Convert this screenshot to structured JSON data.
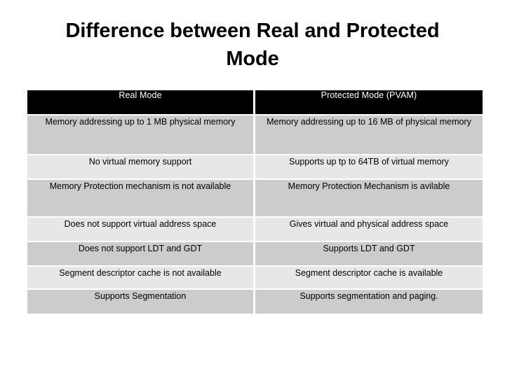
{
  "slide": {
    "title": "Difference between Real and Protected Mode",
    "background_color": "#ffffff"
  },
  "table": {
    "header_background": "#000000",
    "header_text_color": "#ffffff",
    "row_shade_dark": "#cccccc",
    "row_shade_light": "#e7e7e7",
    "columns": [
      {
        "label": "Real Mode"
      },
      {
        "label": "Protected Mode (PVAM)"
      }
    ],
    "rows": [
      {
        "left": "Memory addressing up to 1 MB physical memory",
        "right": "Memory addressing up to 16 MB of physical memory"
      },
      {
        "left": "No virtual memory support",
        "right": "Supports up tp to 64TB of virtual memory"
      },
      {
        "left": "Memory Protection mechanism is not available",
        "right": "Memory Protection Mechanism is avilable"
      },
      {
        "left": "Does not support virtual address space",
        "right": "Gives virtual and physical address space"
      },
      {
        "left": "Does not support LDT and GDT",
        "right": "Supports LDT and GDT"
      },
      {
        "left": "Segment descriptor cache is not available",
        "right": "Segment descriptor cache is available"
      },
      {
        "left": "Supports Segmentation",
        "right": "Supports segmentation and paging."
      }
    ]
  }
}
